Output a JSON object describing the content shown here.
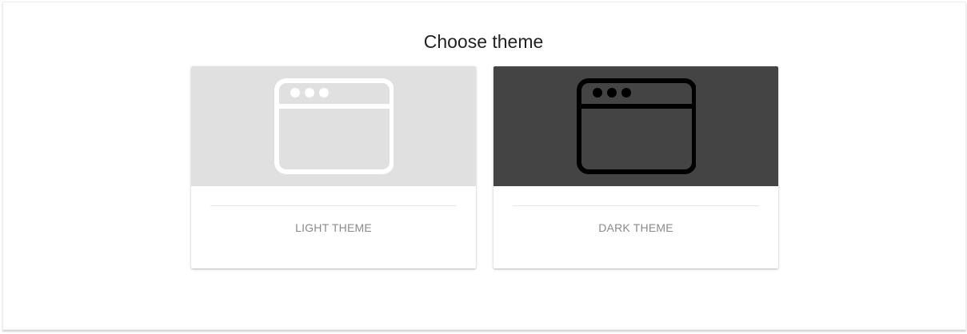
{
  "page": {
    "title": "Choose theme"
  },
  "themes": [
    {
      "label": "LIGHT THEME",
      "icon": "browser-window-icon",
      "preview_bg": "#e0e0e0",
      "icon_color": "#ffffff"
    },
    {
      "label": "DARK THEME",
      "icon": "browser-window-icon",
      "preview_bg": "#444444",
      "icon_color": "#000000"
    }
  ]
}
